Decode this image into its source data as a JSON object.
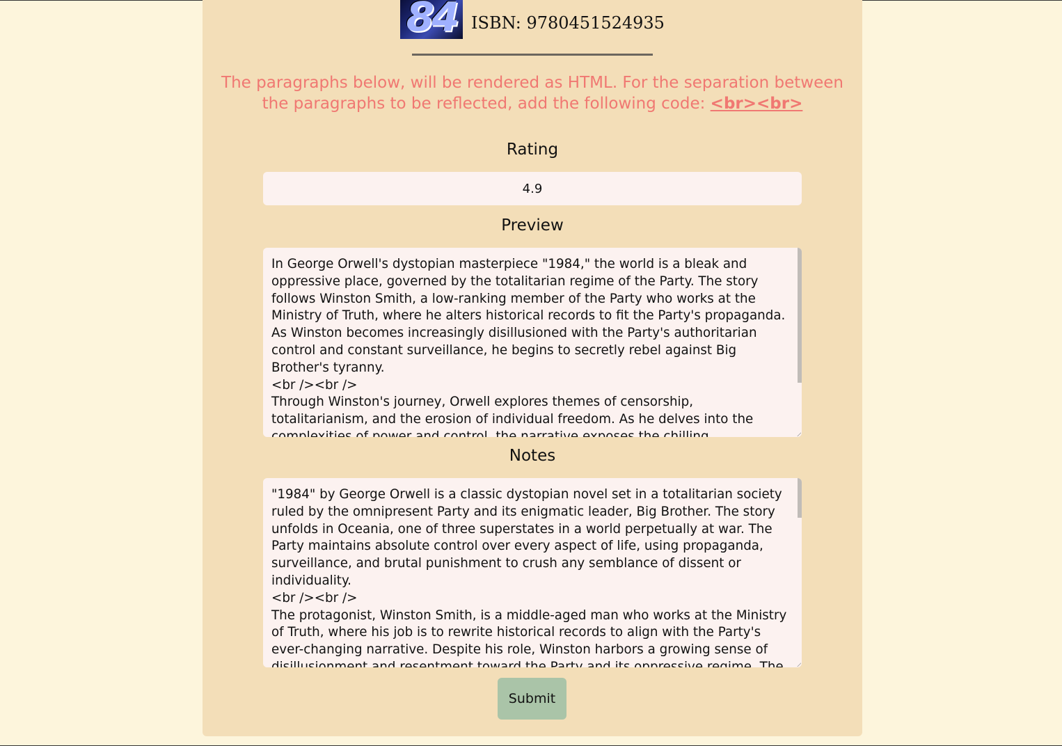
{
  "header": {
    "cover_text": "84",
    "isbn_label": "ISBN: 9780451524935"
  },
  "notice": {
    "text": "The paragraphs below, will be rendered as HTML. For the separation between the paragraphs to be reflected, add the following code: ",
    "code": "<br><br>"
  },
  "rating": {
    "label": "Rating",
    "value": "4.9"
  },
  "preview": {
    "label": "Preview",
    "text": "In George Orwell's dystopian masterpiece \"1984,\" the world is a bleak and oppressive place, governed by the totalitarian regime of the Party. The story follows Winston Smith, a low-ranking member of the Party who works at the Ministry of Truth, where he alters historical records to fit the Party's propaganda. As Winston becomes increasingly disillusioned with the Party's authoritarian control and constant surveillance, he begins to secretly rebel against Big Brother's tyranny.\n<br /><br />\nThrough Winston's journey, Orwell explores themes of censorship, totalitarianism, and the erosion of individual freedom. As he delves into the complexities of power and control, the narrative exposes the chilling consequences of a society stripped"
  },
  "notes": {
    "label": "Notes",
    "text": "\"1984\" by George Orwell is a classic dystopian novel set in a totalitarian society ruled by the omnipresent Party and its enigmatic leader, Big Brother. The story unfolds in Oceania, one of three superstates in a world perpetually at war. The Party maintains absolute control over every aspect of life, using propaganda, surveillance, and brutal punishment to crush any semblance of dissent or individuality.\n<br /><br />\nThe protagonist, Winston Smith, is a middle-aged man who works at the Ministry of Truth, where his job is to rewrite historical records to align with the Party's ever-changing narrative. Despite his role, Winston harbors a growing sense of disillusionment and resentment toward the Party and its oppressive regime. The"
  },
  "submit_label": "Submit"
}
